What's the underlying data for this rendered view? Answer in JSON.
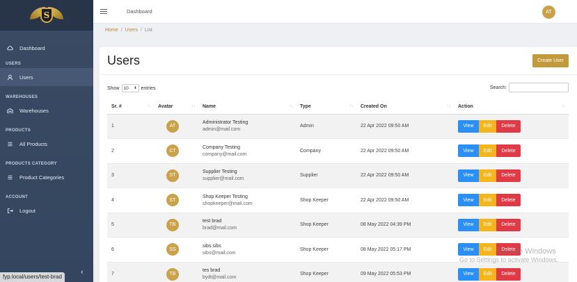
{
  "topbar": {
    "title": "Dashboard",
    "user_initials": "AT"
  },
  "logo": {
    "letter": "S"
  },
  "sidebar": {
    "dashboard": "Dashboard",
    "sections": [
      {
        "heading": "USERS",
        "item": "Users",
        "icon": "user-icon"
      },
      {
        "heading": "WAREHOUSES",
        "item": "Warehouses",
        "icon": "warehouse-icon"
      },
      {
        "heading": "PRODUCTS",
        "item": "All Products",
        "icon": "list-icon"
      },
      {
        "heading": "PRODUCTS CATEGORY",
        "item": "Product Categories",
        "icon": "list-icon"
      },
      {
        "heading": "ACCOUNT",
        "item": "Logout",
        "icon": "logout-icon"
      }
    ],
    "collapse": "‹"
  },
  "breadcrumb": {
    "home": "Home",
    "users": "Users",
    "current": "List"
  },
  "page": {
    "title": "Users",
    "create_button": "Create User",
    "show_label": "Show",
    "entries_value": "10",
    "entries_label": "entries",
    "search_label": "Search:",
    "search_value": ""
  },
  "table": {
    "headers": [
      "Sr. #",
      "Avatar",
      "Name",
      "Type",
      "Created On",
      "Action"
    ],
    "rows": [
      {
        "sr": "1",
        "initials": "AT",
        "name": "Administrator Testing",
        "email": "admin@mail.com",
        "type": "Admin",
        "created": "22 Apr 2022 09:50 AM"
      },
      {
        "sr": "2",
        "initials": "CT",
        "name": "Company Testing",
        "email": "company@mail.com",
        "type": "Company",
        "created": "22 Apr 2022 09:50 AM"
      },
      {
        "sr": "3",
        "initials": "ST",
        "name": "Supplier Testing",
        "email": "supplier@mail.com",
        "type": "Supplier",
        "created": "22 Apr 2022 09:50 AM"
      },
      {
        "sr": "4",
        "initials": "ST",
        "name": "Shop Keeper Testing",
        "email": "shopkeeper@mail.com",
        "type": "Shop Keeper",
        "created": "22 Apr 2022 09:50 AM"
      },
      {
        "sr": "5",
        "initials": "TB",
        "name": "test brad",
        "email": "brad@mail.com",
        "type": "Shop Keeper",
        "created": "08 May 2022 04:39 PM"
      },
      {
        "sr": "6",
        "initials": "SS",
        "name": "sibs sibs",
        "email": "sibs@mail.com",
        "type": "Shop Keeper",
        "created": "08 May 2022 05:17 PM"
      },
      {
        "sr": "7",
        "initials": "TB",
        "name": "tes brad",
        "email": "bydt@mail.com",
        "type": "Shop Keeper",
        "created": "09 May 2022 05:53 PM"
      }
    ],
    "actions": {
      "view": "View",
      "edit": "Edit",
      "delete": "Delete"
    }
  },
  "status_bar": {
    "url": "fyp.local/users/test-brad"
  },
  "watermark": {
    "line1": "Activate Windows",
    "line2": "Go to Settings to activate Windows."
  },
  "colors": {
    "accent": "#c39a3b",
    "sidebar": "#3a4a63",
    "view": "#2a8ff7",
    "edit": "#f5b51d",
    "delete": "#e03a46"
  }
}
